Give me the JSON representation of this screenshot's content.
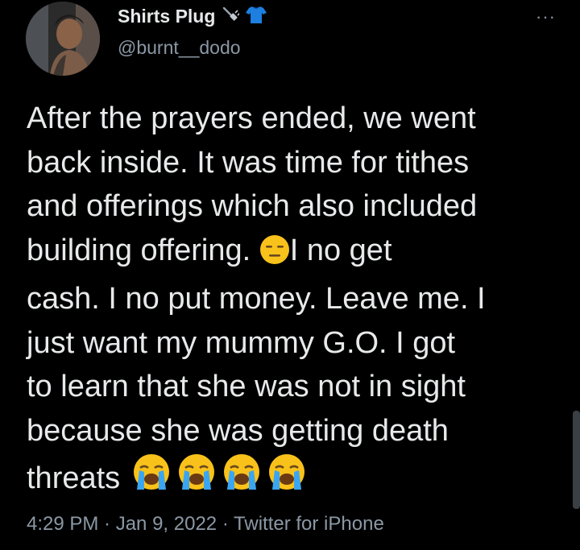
{
  "author": {
    "display_name": "Shirts Plug",
    "handle": "@burnt__dodo",
    "icons": [
      "plug-icon",
      "shirt-icon"
    ]
  },
  "tweet": {
    "text_lines": [
      "After the prayers ended, we went",
      "back inside. It was time for tithes",
      "and offerings which also included",
      "building offering. ",
      "I no get",
      "cash. I no put money. Leave me. I",
      "just want my mummy G.O. I got",
      "to learn that she was not in sight",
      "because she was getting death",
      "threats "
    ],
    "emojis": [
      "expressionless-face-emoji",
      "loudly-crying-face-emoji"
    ]
  },
  "meta": {
    "text": "4:29 PM · Jan 9, 2022 · Twitter for iPhone"
  },
  "menu": {
    "more_label": "···"
  },
  "colors": {
    "background": "#000000",
    "text": "#e7e9ea",
    "secondary": "#8b98a5",
    "shirt_blue": "#1d9bf0"
  }
}
